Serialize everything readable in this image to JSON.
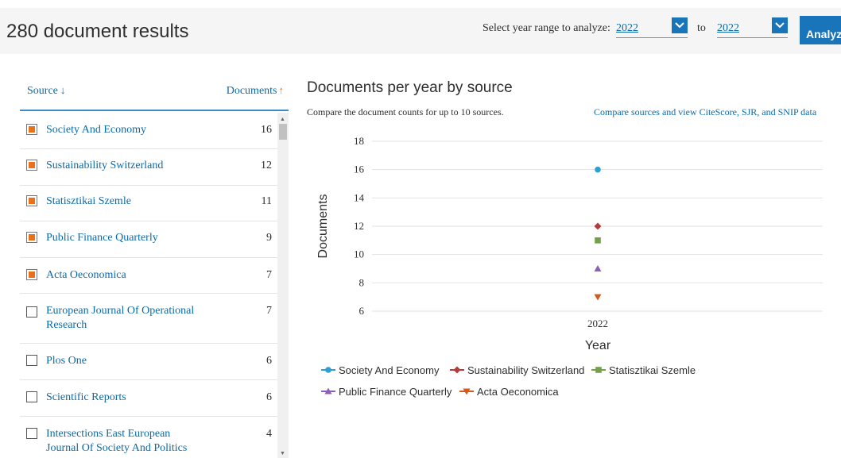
{
  "header": {
    "results_title": "280 document results",
    "range_label": "Select year range to analyze:",
    "year_from": "2022",
    "to_label": "to",
    "year_to": "2022",
    "analyze_label": "Analyze"
  },
  "source_list": {
    "source_header": "Source",
    "documents_header": "Documents",
    "items": [
      {
        "name": "Society And Economy",
        "count": "16",
        "checked": true
      },
      {
        "name": "Sustainability Switzerland",
        "count": "12",
        "checked": true
      },
      {
        "name": "Statisztikai Szemle",
        "count": "11",
        "checked": true
      },
      {
        "name": "Public Finance Quarterly",
        "count": "9",
        "checked": true
      },
      {
        "name": "Acta Oeconomica",
        "count": "7",
        "checked": true
      },
      {
        "name": "European Journal Of Operational Research",
        "count": "7",
        "checked": false
      },
      {
        "name": "Plos One",
        "count": "6",
        "checked": false
      },
      {
        "name": "Scientific Reports",
        "count": "6",
        "checked": false
      },
      {
        "name": "Intersections East European Journal Of Society And Politics",
        "count": "4",
        "checked": false
      }
    ]
  },
  "chart_panel": {
    "title": "Documents per year by source",
    "subtitle": "Compare the document counts for up to 10 sources.",
    "compare_link": "Compare sources and view CiteScore, SJR, and SNIP data"
  },
  "chart_data": {
    "type": "scatter",
    "title": "",
    "xlabel": "Year",
    "ylabel": "Documents",
    "categories": [
      "2022"
    ],
    "ylim": [
      6,
      18
    ],
    "yticks": [
      6,
      8,
      10,
      12,
      14,
      16,
      18
    ],
    "grid": true,
    "legend_position": "bottom",
    "series": [
      {
        "name": "Society And Economy",
        "values": [
          16
        ],
        "color": "#2b9fd6",
        "marker": "circle"
      },
      {
        "name": "Sustainability Switzerland",
        "values": [
          12
        ],
        "color": "#b83b3b",
        "marker": "diamond"
      },
      {
        "name": "Statisztikai Szemle",
        "values": [
          11
        ],
        "color": "#74a04a",
        "marker": "square"
      },
      {
        "name": "Public Finance Quarterly",
        "values": [
          9
        ],
        "color": "#8e5fb8",
        "marker": "triangle-up"
      },
      {
        "name": "Acta Oeconomica",
        "values": [
          7
        ],
        "color": "#d35a1c",
        "marker": "triangle-down"
      }
    ]
  },
  "colors": {
    "accent": "#1a74ba",
    "link": "#0b6aa8",
    "sort_arrow": "#e9711c",
    "checkbox_fill": "#e9711c"
  }
}
